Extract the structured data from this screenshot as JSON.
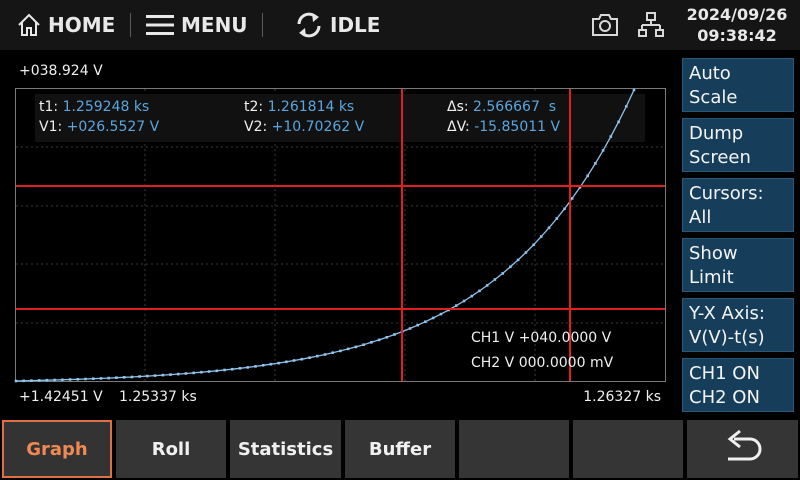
{
  "topbar": {
    "home_label": "HOME",
    "menu_label": "MENU",
    "status_label": "IDLE",
    "date": "2024/09/26",
    "time": "09:38:42",
    "icons": [
      "home-icon",
      "hamburger-icon",
      "refresh-icon",
      "camera-icon",
      "network-icon"
    ]
  },
  "graph": {
    "y_max_label": "+038.924 V",
    "y_min_label": "+1.42451 V",
    "x_min_label": "1.25337 ks",
    "x_max_label": "1.26327 ks",
    "cursor_color": "#e02020",
    "trace_color": "#8ec4ee",
    "cursors": {
      "t1_label": "t1:",
      "t1_value": "1.259248 ks",
      "v1_label": "V1:",
      "v1_value": "+026.5527 V",
      "t2_label": "t2:",
      "t2_value": "1.261814 ks",
      "v2_label": "V2:",
      "v2_value": "+10.70262 V",
      "ds_label": "Δs:",
      "ds_value": "2.566667  s",
      "dv_label": "ΔV:",
      "dv_value": "-15.85011 V"
    },
    "ch1_readout": "CH1 V +040.0000 V",
    "ch2_readout": "CH2 V 000.0000 mV"
  },
  "side_buttons": [
    {
      "label": "Auto\nScale"
    },
    {
      "label": "Dump\nScreen"
    },
    {
      "label": "Cursors:\nAll"
    },
    {
      "label": "Show\nLimit"
    },
    {
      "label": "Y-X Axis:\nV(V)-t(s)"
    },
    {
      "label": "CH1 ON\nCH2 ON"
    }
  ],
  "tabs": [
    {
      "label": "Graph",
      "active": true
    },
    {
      "label": "Roll"
    },
    {
      "label": "Statistics"
    },
    {
      "label": "Buffer"
    },
    {
      "label": ""
    },
    {
      "label": ""
    },
    {
      "label": "",
      "icon": "back-arrow-icon"
    }
  ],
  "accent_color": "#e07040",
  "side_button_color": "#163e5b"
}
